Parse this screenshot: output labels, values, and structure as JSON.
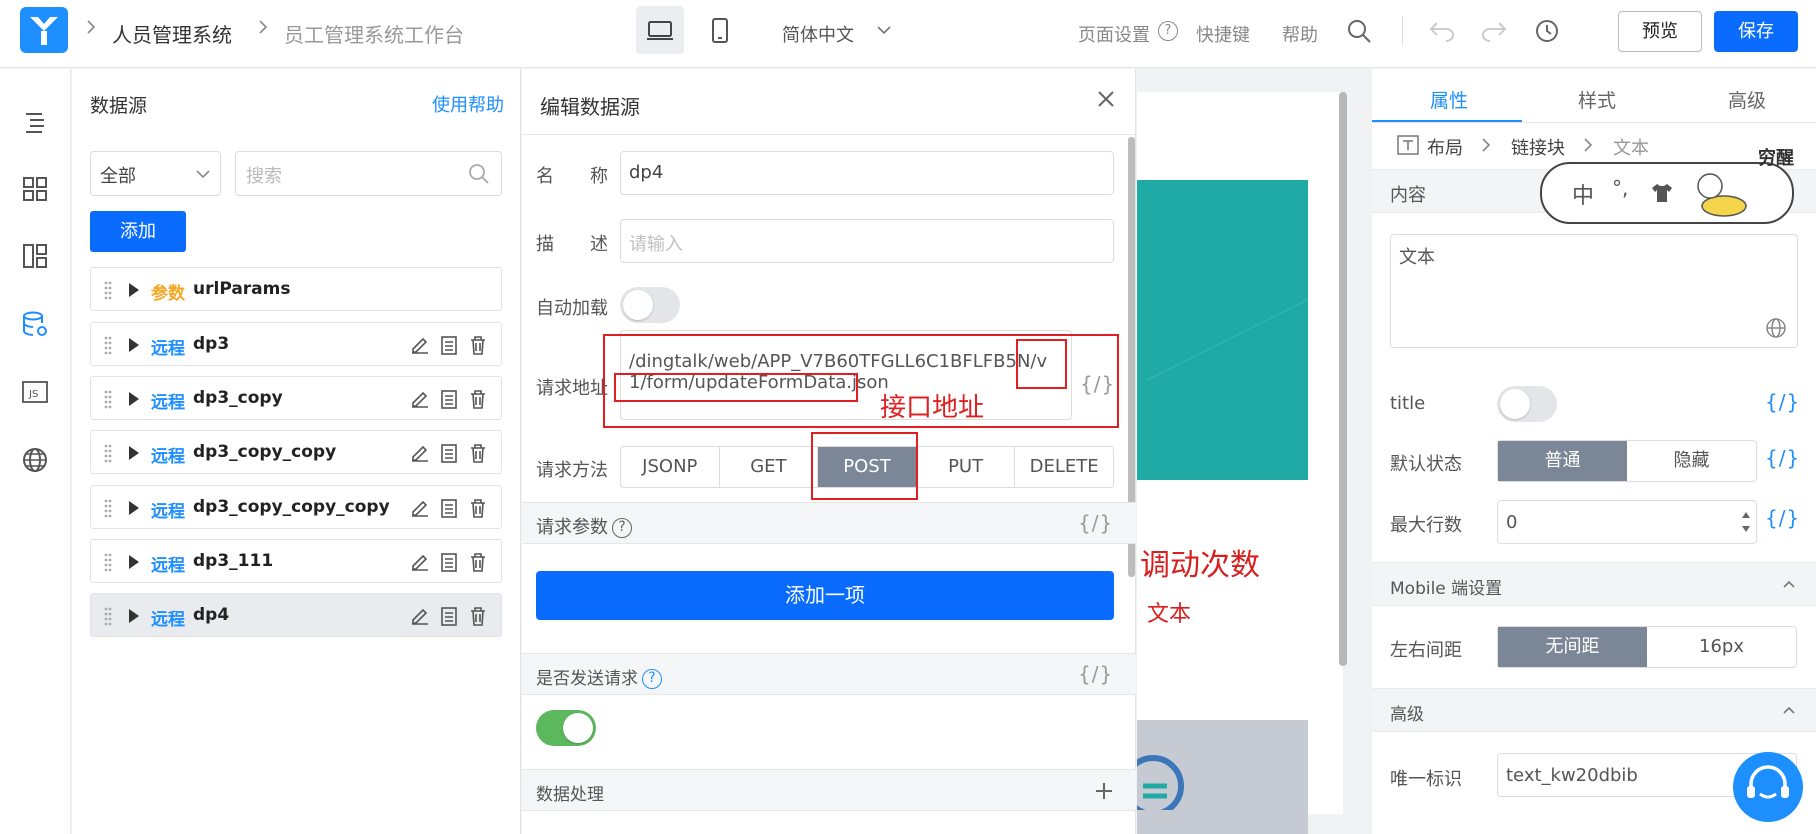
{
  "header": {
    "crumb1": "人员管理系统",
    "crumb2": "员工管理系统工作台",
    "lang": "简体中文",
    "page_settings": "页面设置",
    "shortcuts": "快捷键",
    "help": "帮助",
    "preview": "预览",
    "save": "保存"
  },
  "datasource": {
    "title": "数据源",
    "help_link": "使用帮助",
    "filter": "全部",
    "search_placeholder": "搜索",
    "add": "添加",
    "items": [
      {
        "type": "参数",
        "name": "urlParams"
      },
      {
        "type": "远程",
        "name": "dp3"
      },
      {
        "type": "远程",
        "name": "dp3_copy"
      },
      {
        "type": "远程",
        "name": "dp3_copy_copy"
      },
      {
        "type": "远程",
        "name": "dp3_copy_copy_copy"
      },
      {
        "type": "远程",
        "name": "dp3_111"
      },
      {
        "type": "远程",
        "name": "dp4"
      }
    ]
  },
  "editor": {
    "title": "编辑数据源",
    "name_label": "名　　称",
    "name_value": "dp4",
    "desc_label": "描　　述",
    "desc_placeholder": "请输入",
    "autoload_label": "自动加载",
    "url_label": "请求地址",
    "url_value": "/dingtalk/web/APP_V7B60TFGLL6C1BFLFB5N/v1/form/updateFormData.json",
    "method_label": "请求方法",
    "methods": [
      "JSONP",
      "GET",
      "POST",
      "PUT",
      "DELETE"
    ],
    "params_label": "请求参数",
    "add_item": "添加一项",
    "send_label": "是否发送请求",
    "process_label": "数据处理",
    "fx": "{/}"
  },
  "annotations": {
    "api_label": "接口地址"
  },
  "canvas": {
    "big_text": "调动次数",
    "small_text": "文本"
  },
  "props": {
    "tabs": [
      "属性",
      "样式",
      "高级"
    ],
    "path": [
      "布局",
      "链接块",
      "文本"
    ],
    "content_label": "内容",
    "text_value": "文本",
    "title_label": "title",
    "state_label": "默认状态",
    "state_options": [
      "普通",
      "隐藏"
    ],
    "maxrows_label": "最大行数",
    "maxrows_value": "0",
    "mobile_label": "Mobile 端设置",
    "spacing_label": "左右间距",
    "spacing_options": [
      "无间距",
      "16px"
    ],
    "advanced_label": "高级",
    "id_label": "唯一标识",
    "id_value": "text_kw20dbib"
  },
  "ime": {
    "char": "中",
    "punct": "°,",
    "badge": "穷醒"
  },
  "colors": {
    "primary": "#0a6cff",
    "accent": "#1e8fff",
    "teal": "#20aaa6",
    "annotation": "#e02020"
  }
}
